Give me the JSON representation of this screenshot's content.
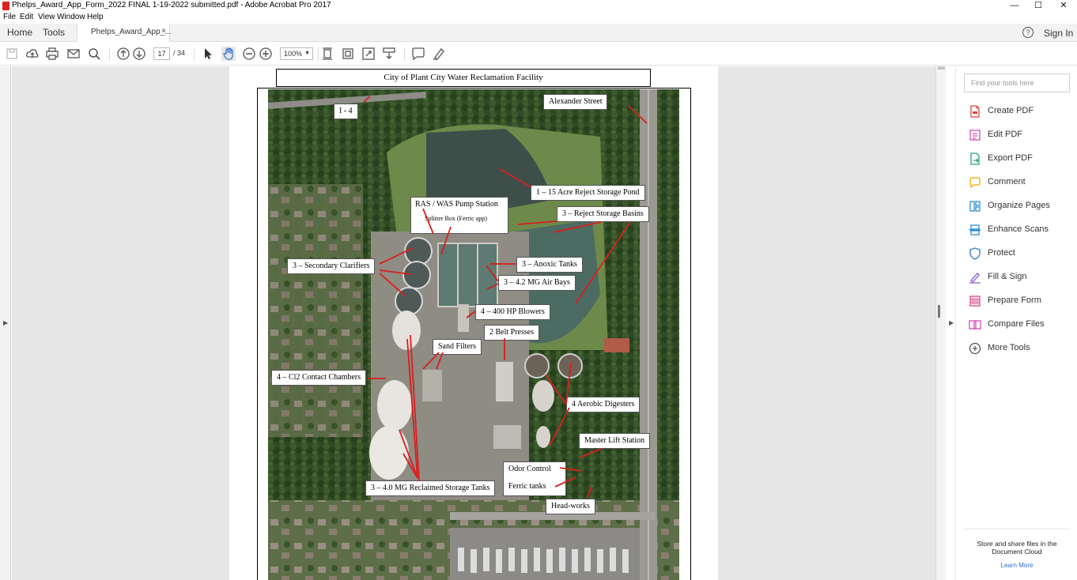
{
  "window": {
    "title": "Phelps_Award_App_Form_2022 FINAL 1-19-2022 submitted.pdf - Adobe Acrobat Pro 2017",
    "minimize": "—",
    "maximize": "☐",
    "close": "✕"
  },
  "menu": [
    "File",
    "Edit",
    "View",
    "Window",
    "Help"
  ],
  "tabs": {
    "home": "Home",
    "tools": "Tools",
    "document": "Phelps_Award_App_...",
    "document_close": "×",
    "help": "?",
    "sign_in": "Sign In"
  },
  "toolbar": {
    "current_page": "17",
    "total_pages": "/ 34",
    "zoom": "100%"
  },
  "document": {
    "header": "City of Plant City Water Reclamation Facility",
    "labels": {
      "i4": "I - 4",
      "alexander": "Alexander Street",
      "reject_pond": "1 – 15 Acre Reject Storage Pond",
      "ras_was": "RAS / WAS Pump Station",
      "splitter": "Splitter Box (Ferric app)",
      "reject_basins": "3 – Reject Storage Basins",
      "secondary": "3 – Secondary Clarifiers",
      "anoxic": "3 – Anoxic Tanks",
      "air_bays": "3 – 4.2 MG Air Bays",
      "blowers": "4 – 400 HP Blowers",
      "belt": "2 Belt Presses",
      "sand": "Sand Filters",
      "cl2": "4 – Cl2 Contact Chambers",
      "digesters": "4 Aerobic Digesters",
      "master_lift": "Master Lift Station",
      "odor": "Odor Control",
      "ferric": "Ferric tanks",
      "headworks": "Head-works",
      "reclaimed": "3 – 4.0 MG Reclaimed Storage Tanks"
    }
  },
  "right_pane": {
    "search_placeholder": "Find your tools here",
    "tools": [
      {
        "label": "Create PDF",
        "icon": "create-pdf-icon",
        "color": "#e0413a"
      },
      {
        "label": "Edit PDF",
        "icon": "edit-pdf-icon",
        "color": "#d24bb5"
      },
      {
        "label": "Export PDF",
        "icon": "export-pdf-icon",
        "color": "#1ea37a"
      },
      {
        "label": "Comment",
        "icon": "comment-icon",
        "color": "#f2b51d"
      },
      {
        "label": "Organize Pages",
        "icon": "organize-pages-icon",
        "color": "#2b8fd8"
      },
      {
        "label": "Enhance Scans",
        "icon": "enhance-scans-icon",
        "color": "#2b8fd8"
      },
      {
        "label": "Protect",
        "icon": "protect-icon",
        "color": "#3f7fcf"
      },
      {
        "label": "Fill & Sign",
        "icon": "fill-sign-icon",
        "color": "#8a5ad6"
      },
      {
        "label": "Prepare Form",
        "icon": "prepare-form-icon",
        "color": "#d6417f"
      },
      {
        "label": "Compare Files",
        "icon": "compare-files-icon",
        "color": "#d24bb5"
      },
      {
        "label": "More Tools",
        "icon": "more-tools-icon",
        "color": "#555555"
      }
    ],
    "cloud_text": "Store and share files in the Document Cloud",
    "learn_more": "Learn More"
  }
}
